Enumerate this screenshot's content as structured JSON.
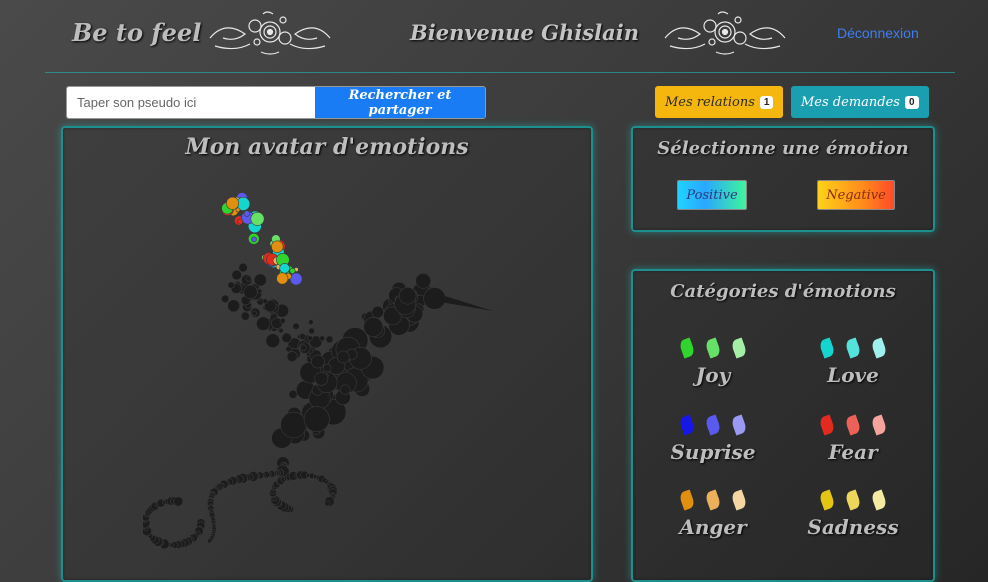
{
  "header": {
    "brand": "Be to feel",
    "welcome": "Bienvenue Ghislain",
    "logout": "Déconnexion"
  },
  "search": {
    "placeholder": "Taper son pseudo ici",
    "button": "Rechercher et partager"
  },
  "relations": {
    "label": "Mes relations",
    "count": "1"
  },
  "requests": {
    "label": "Mes demandes",
    "count": "0"
  },
  "avatar_panel": {
    "title": "Mon avatar d'emotions"
  },
  "select_panel": {
    "title": "Sélectionne une émotion",
    "positive": "Positive",
    "negative": "Negative"
  },
  "categories_panel": {
    "title": "Catégories d'émotions",
    "items": [
      {
        "name": "Joy",
        "colors": [
          "#2fd42f",
          "#67e067",
          "#a6eea6"
        ]
      },
      {
        "name": "Love",
        "colors": [
          "#14d6cf",
          "#55e2dd",
          "#a0efec"
        ]
      },
      {
        "name": "Suprise",
        "colors": [
          "#1616e8",
          "#5a5aee",
          "#9a9af5"
        ]
      },
      {
        "name": "Fear",
        "colors": [
          "#e22b1e",
          "#ec6258",
          "#f4a39d"
        ]
      },
      {
        "name": "Anger",
        "colors": [
          "#e08f0f",
          "#ecb05a",
          "#f5d6a3"
        ]
      },
      {
        "name": "Sadness",
        "colors": [
          "#e3c512",
          "#ecd75a",
          "#f5eaa3"
        ]
      }
    ]
  },
  "colors": {
    "accent_teal": "#1e8f8f",
    "primary_blue": "#1a7cf5",
    "warning_yellow": "#f5b70d",
    "info_teal": "#1a9fb0"
  }
}
